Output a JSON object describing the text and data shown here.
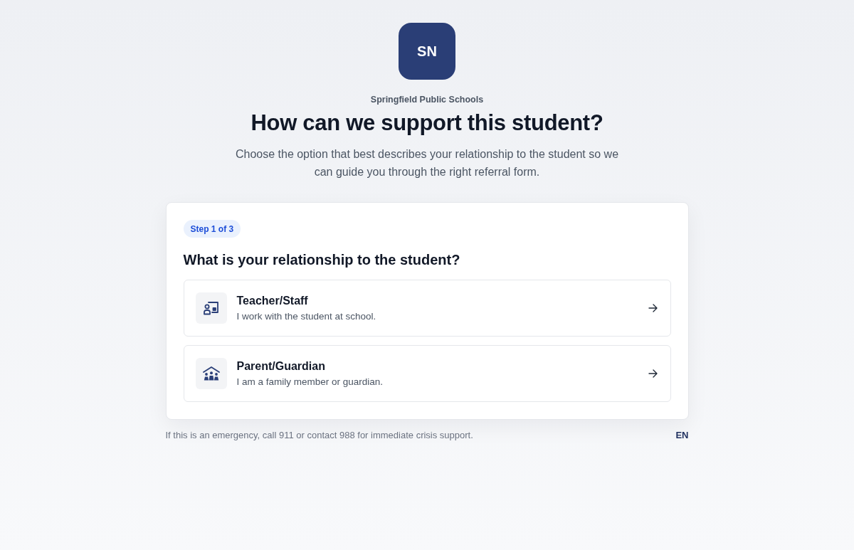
{
  "logo": {
    "initials": "SN"
  },
  "header": {
    "organization": "Springfield Public Schools",
    "title": "How can we support this student?",
    "subtitle": "Choose the option that best describes your relationship to the student so we can guide you through the right referral form."
  },
  "card": {
    "step_badge": "Step 1 of 3",
    "question": "What is your relationship to the student?",
    "options": [
      {
        "kind": "teacher",
        "title": "Teacher/Staff",
        "description": "I work with the student at school."
      },
      {
        "kind": "family",
        "title": "Parent/Guardian",
        "description": "I am a family member or guardian."
      }
    ]
  },
  "footer": {
    "notice": "If this is an emergency, call 911 or contact 988 for immediate crisis support.",
    "language": "EN"
  }
}
